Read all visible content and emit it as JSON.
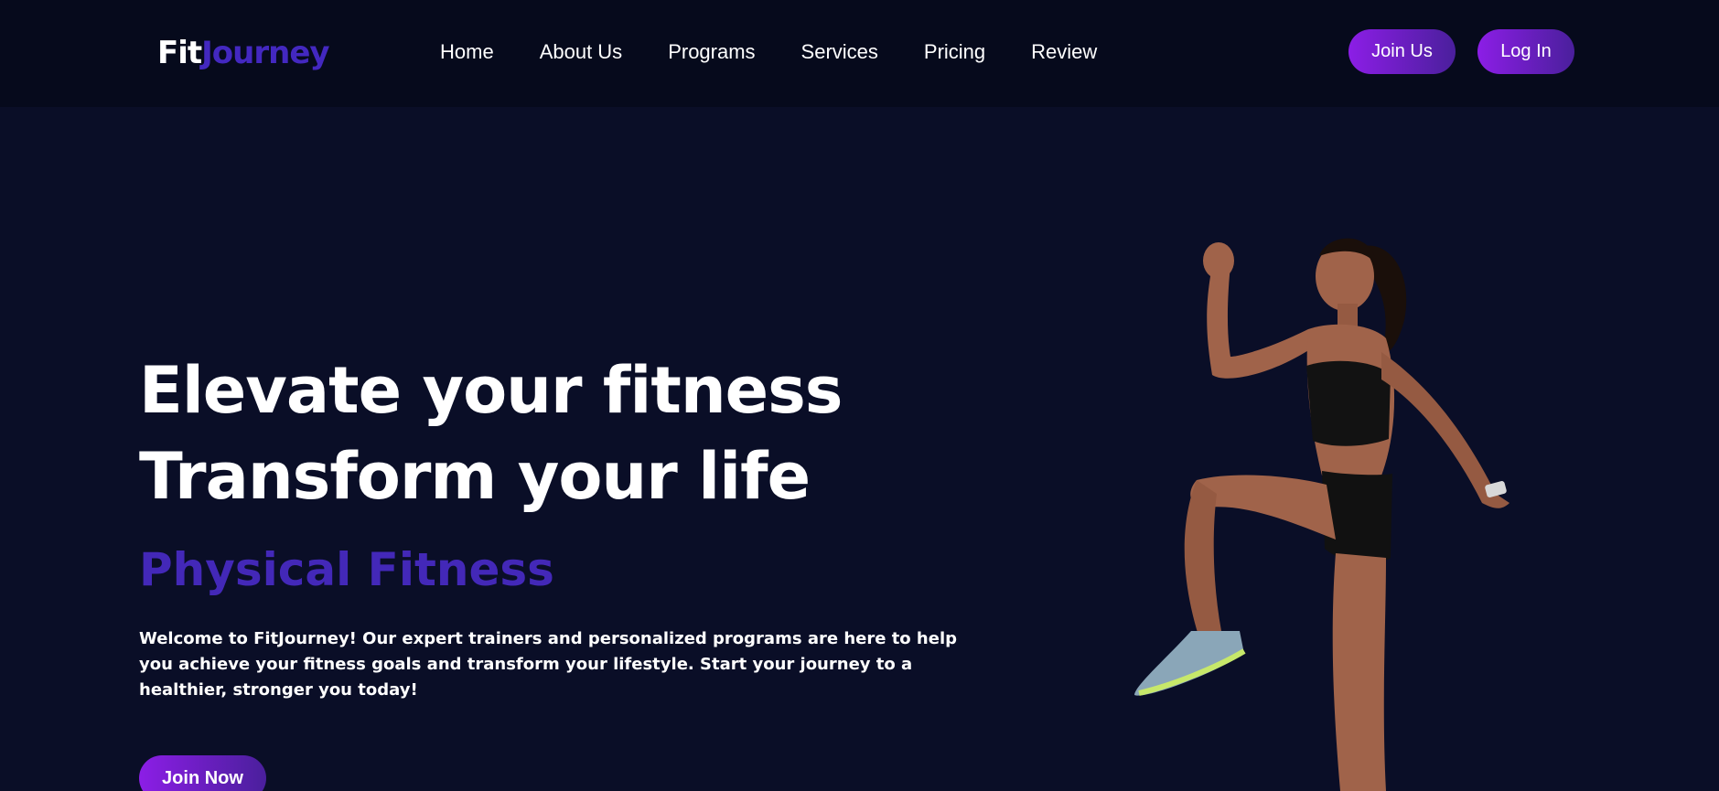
{
  "brand": {
    "part1": "Fit",
    "part2": "Journey"
  },
  "nav": {
    "links": [
      "Home",
      "About Us",
      "Programs",
      "Services",
      "Pricing",
      "Review"
    ],
    "join_label": "Join Us",
    "login_label": "Log In"
  },
  "hero": {
    "title_line1": "Elevate your fitness",
    "title_line2": "Transform your life",
    "subtitle": "Physical Fitness",
    "description": "Welcome to FitJourney! Our expert trainers and personalized programs are here to help you achieve your fitness goals and transform your lifestyle. Start your journey to a healthier, stronger you today!",
    "cta_label": "Join Now",
    "image_icon": "athlete-running-photo"
  },
  "colors": {
    "background": "#0a0e27",
    "navbar": "#060a1c",
    "accent": "#4328c0",
    "button_gradient_start": "#8c1ee6",
    "button_gradient_end": "#4a1f9c"
  }
}
